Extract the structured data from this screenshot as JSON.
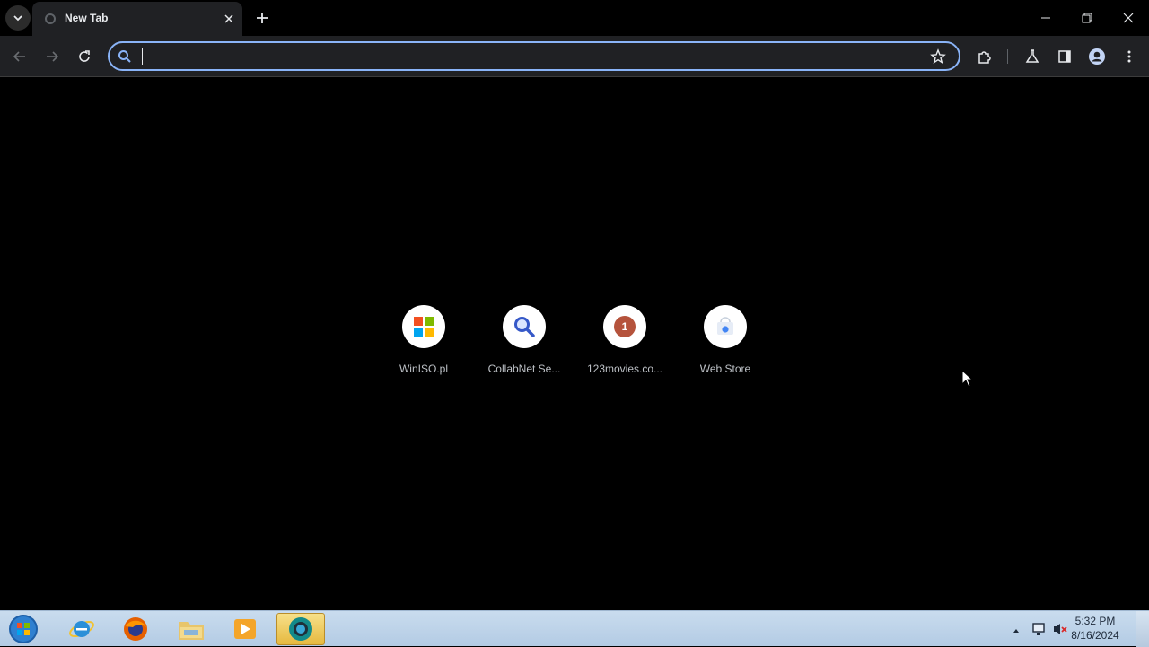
{
  "browser": {
    "tab": {
      "title": "New Tab",
      "favicon": "globe-icon"
    },
    "omnibox": {
      "value": "",
      "placeholder": ""
    },
    "colors": {
      "background": "#000000",
      "toolbar": "#202124",
      "focus_ring": "#8ab4f8"
    }
  },
  "shortcuts": [
    {
      "label": "WinISO.pl",
      "icon": "windows-logo-icon"
    },
    {
      "label": "CollabNet Se...",
      "icon": "search-magnifier-icon"
    },
    {
      "label": "123movies.co...",
      "icon": "badge-1-icon",
      "badge_text": "1"
    },
    {
      "label": "Web Store",
      "icon": "web-store-icon"
    }
  ],
  "taskbar": {
    "apps": [
      "internet-explorer-icon",
      "firefox-icon",
      "file-explorer-icon",
      "media-player-icon",
      "chrome-beta-icon"
    ],
    "clock": {
      "time": "5:32 PM",
      "date": "8/16/2024"
    }
  }
}
